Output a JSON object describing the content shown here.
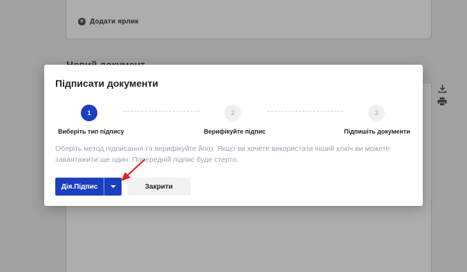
{
  "background": {
    "add_label": "Додати ярлик",
    "section_title": "Новий документ"
  },
  "icons": {
    "download": "download-icon",
    "print": "printer-icon"
  },
  "modal": {
    "title": "Підписати документи",
    "steps": [
      {
        "number": "1",
        "label": "Виберіть тип підпису",
        "active": true
      },
      {
        "number": "2",
        "label": "Верифікуйте підпис",
        "active": false
      },
      {
        "number": "3",
        "label": "Підпишіть документи",
        "active": false
      }
    ],
    "description": "Оберіть метод підписання та верифікуйте його. Якщо ви хочете використати інший ключ ви можете завантажити ще один. Попередній підпис буде стерто.",
    "primary_button_label": "Дія.Підпис",
    "close_button_label": "Закрити"
  },
  "colors": {
    "primary": "#1a3fbf",
    "annotation": "#e41e1e"
  }
}
